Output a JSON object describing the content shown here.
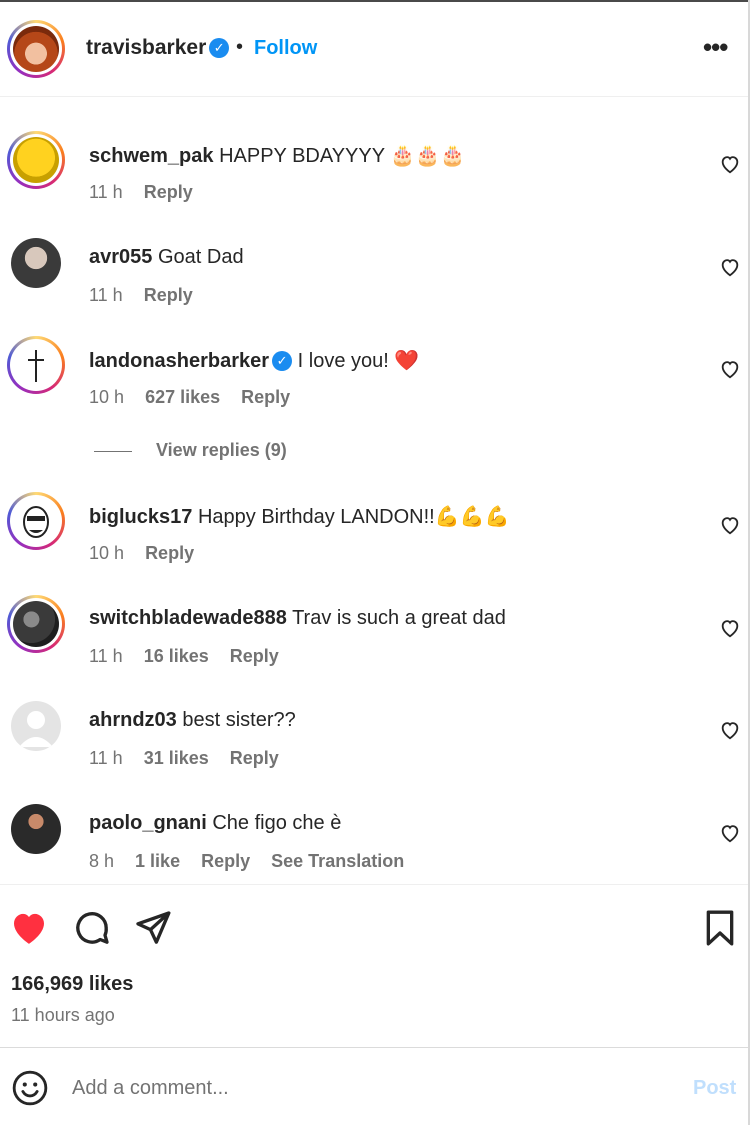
{
  "post_header": {
    "username": "travisbarker",
    "separator": "•",
    "follow_label": "Follow",
    "more_icon": "more-horizontal-icon"
  },
  "comments": [
    {
      "username": "schwem_pak",
      "text": "HAPPY BDAYYYY 🎂🎂🎂",
      "time": "11 h",
      "likes": "",
      "reply_label": "Reply"
    },
    {
      "username": "avr055",
      "text": "Goat Dad",
      "time": "11 h",
      "likes": "",
      "reply_label": "Reply"
    },
    {
      "username": "landonasherbarker",
      "text": "I love you! ❤️",
      "time": "10 h",
      "likes": "627 likes",
      "reply_label": "Reply",
      "verified": true
    },
    {
      "username": "biglucks17",
      "text": "Happy Birthday LANDON!!💪💪💪",
      "time": "10 h",
      "likes": "",
      "reply_label": "Reply"
    },
    {
      "username": "switchbladewade888",
      "text": "Trav is such a great dad",
      "time": "11 h",
      "likes": "16 likes",
      "reply_label": "Reply"
    },
    {
      "username": "ahrndz03",
      "text": "best sister??",
      "time": "11 h",
      "likes": "31 likes",
      "reply_label": "Reply"
    },
    {
      "username": "paolo_gnani",
      "text": "Che figo che è",
      "time": "8 h",
      "likes": "1 like",
      "reply_label": "Reply",
      "translation_label": "See Translation"
    }
  ],
  "view_replies": "View replies (9)",
  "actions": {
    "likes_count": "166,969 likes",
    "time_ago": "11 hours ago",
    "liked": true,
    "like_color": "#ff3040"
  },
  "comment_box": {
    "placeholder": "Add a comment...",
    "post_label": "Post"
  },
  "colors": {
    "link_blue": "#0095f6",
    "verified_blue": "#1a8cf0",
    "muted_text": "#737373",
    "post_disabled": "#c0dffd"
  }
}
